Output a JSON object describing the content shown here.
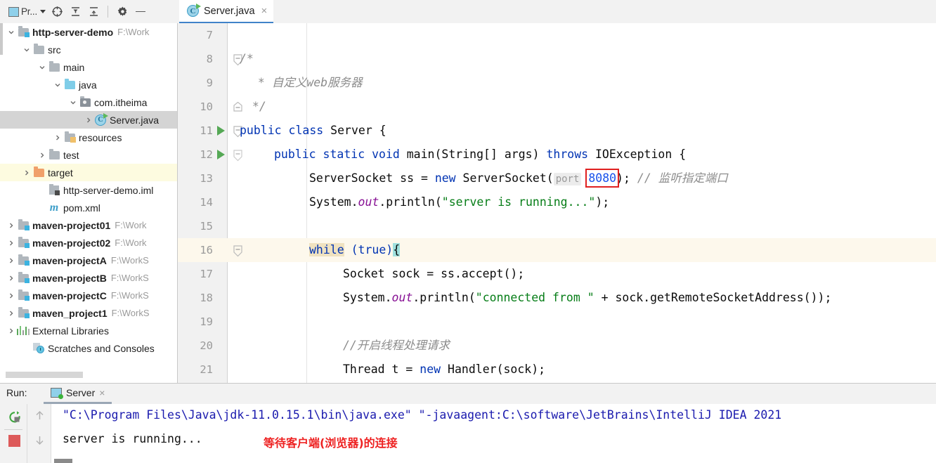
{
  "toolbar": {
    "project_label": "Pr...",
    "icons": [
      "project-view-icon",
      "locate-icon",
      "expand-all-icon",
      "collapse-all-icon",
      "settings-gear-icon",
      "hide-icon"
    ]
  },
  "tabs": [
    {
      "label": "Server.java",
      "icon": "java-class-icon",
      "close": "×",
      "active": true
    }
  ],
  "sidebar": {
    "items": [
      {
        "label": "http-server-demo",
        "path": "F:\\Work",
        "indent": 0,
        "arrow": "down",
        "icon": "module-folder-icon",
        "bold": true
      },
      {
        "label": "src",
        "path": "",
        "indent": 1,
        "arrow": "down",
        "icon": "folder-icon",
        "bold": false
      },
      {
        "label": "main",
        "path": "",
        "indent": 2,
        "arrow": "down",
        "icon": "folder-icon",
        "bold": false
      },
      {
        "label": "java",
        "path": "",
        "indent": 3,
        "arrow": "down",
        "icon": "source-folder-icon",
        "bold": false
      },
      {
        "label": "com.itheima",
        "path": "",
        "indent": 4,
        "arrow": "down",
        "icon": "package-icon",
        "bold": false
      },
      {
        "label": "Server.java",
        "path": "",
        "indent": 5,
        "arrow": "right",
        "icon": "java-class-icon",
        "bold": false,
        "state": "selected"
      },
      {
        "label": "resources",
        "path": "",
        "indent": 4,
        "arrow": "right",
        "icon": "resources-folder-icon",
        "bold": false
      },
      {
        "label": "test",
        "path": "",
        "indent": 3,
        "arrow": "right",
        "icon": "folder-icon",
        "bold": false
      },
      {
        "label": "target",
        "path": "",
        "indent": 2,
        "arrow": "right",
        "icon": "excluded-folder-icon",
        "bold": false,
        "state": "highlighted"
      },
      {
        "label": "http-server-demo.iml",
        "path": "",
        "indent": 3,
        "arrow": "none",
        "icon": "iml-file-icon",
        "bold": false
      },
      {
        "label": "pom.xml",
        "path": "",
        "indent": 3,
        "arrow": "none",
        "icon": "maven-file-icon",
        "bold": false
      },
      {
        "label": "maven-project01",
        "path": "F:\\Work",
        "indent": 0,
        "arrow": "right",
        "icon": "module-folder-icon",
        "bold": true
      },
      {
        "label": "maven-project02",
        "path": "F:\\Work",
        "indent": 0,
        "arrow": "right",
        "icon": "module-folder-icon",
        "bold": true
      },
      {
        "label": "maven-projectA",
        "path": "F:\\WorkS",
        "indent": 0,
        "arrow": "right",
        "icon": "module-folder-icon",
        "bold": true
      },
      {
        "label": "maven-projectB",
        "path": "F:\\WorkS",
        "indent": 0,
        "arrow": "right",
        "icon": "module-folder-icon",
        "bold": true
      },
      {
        "label": "maven-projectC",
        "path": "F:\\WorkS",
        "indent": 0,
        "arrow": "right",
        "icon": "module-folder-icon",
        "bold": true
      },
      {
        "label": "maven_project1",
        "path": "F:\\WorkS",
        "indent": 0,
        "arrow": "right",
        "icon": "module-folder-icon",
        "bold": true
      },
      {
        "label": "External Libraries",
        "path": "",
        "indent": 0,
        "arrow": "right",
        "icon": "libraries-icon",
        "bold": false
      },
      {
        "label": "Scratches and Consoles",
        "path": "",
        "indent": 0,
        "arrow": "none",
        "icon": "scratches-icon",
        "bold": false
      }
    ]
  },
  "editor": {
    "file": "Server.java",
    "first_line_number": 7,
    "lines": [
      {
        "num": "7",
        "runmark": false,
        "fold": "none",
        "cur": false
      },
      {
        "num": "8",
        "runmark": false,
        "fold": "open",
        "cur": false
      },
      {
        "num": "9",
        "runmark": false,
        "fold": "none",
        "cur": false
      },
      {
        "num": "10",
        "runmark": false,
        "fold": "end",
        "cur": false
      },
      {
        "num": "11",
        "runmark": true,
        "fold": "open",
        "cur": false
      },
      {
        "num": "12",
        "runmark": true,
        "fold": "open",
        "cur": false
      },
      {
        "num": "13",
        "runmark": false,
        "fold": "none",
        "cur": false
      },
      {
        "num": "14",
        "runmark": false,
        "fold": "none",
        "cur": false
      },
      {
        "num": "15",
        "runmark": false,
        "fold": "none",
        "cur": false
      },
      {
        "num": "16",
        "runmark": false,
        "fold": "open",
        "cur": true
      },
      {
        "num": "17",
        "runmark": false,
        "fold": "none",
        "cur": false
      },
      {
        "num": "18",
        "runmark": false,
        "fold": "none",
        "cur": false
      },
      {
        "num": "19",
        "runmark": false,
        "fold": "none",
        "cur": false
      },
      {
        "num": "20",
        "runmark": false,
        "fold": "none",
        "cur": false
      },
      {
        "num": "21",
        "runmark": false,
        "fold": "none",
        "cur": false
      }
    ],
    "code": {
      "l8": "/*",
      "l9_star": " * ",
      "l9_text": "自定义web服务器",
      "l10": " */",
      "l11_public": "public",
      "l11_class": "class",
      "l11_name": "Server {",
      "l12_mods": "public static void",
      "l12_main": "main",
      "l12_args": "(String[] args) ",
      "l12_throws": "throws",
      "l12_rest": " IOException {",
      "l13_a": "ServerSocket ss = ",
      "l13_new": "new",
      "l13_b": " ServerSocket(",
      "l13_hint": "port",
      "l13_port": "8080",
      "l13_c": "); ",
      "l13_comment": "// 监听指定端口",
      "l14_a": "System.",
      "l14_out": "out",
      "l14_b": ".println(",
      "l14_str": "\"server is running...\"",
      "l14_c": ");",
      "l16_while": "while",
      "l16_cond": " (true)",
      "l16_brace": "{",
      "l17": "Socket sock = ss.accept();",
      "l18_a": "System.",
      "l18_out": "out",
      "l18_b": ".println(",
      "l18_str": "\"connected from \"",
      "l18_c": " + sock.getRemoteSocketAddress());",
      "l20_comment": "//开启线程处理请求",
      "l21_a": "Thread t = ",
      "l21_new": "new",
      "l21_b": " Handler(sock);"
    },
    "highlight_box": {
      "target": "8080",
      "color": "#e02020"
    }
  },
  "run_panel": {
    "run_label": "Run:",
    "tab_label": "Server",
    "tab_close": "×",
    "buttons": [
      "rerun-button",
      "stop-button",
      "scroll-up-button",
      "scroll-down-button"
    ],
    "console": {
      "line1": "\"C:\\Program Files\\Java\\jdk-11.0.15.1\\bin\\java.exe\" \"-javaagent:C:\\software\\JetBrains\\IntelliJ IDEA 2021",
      "line2": "server is running...",
      "annotation": "等待客户端(浏览器)的连接"
    }
  },
  "colors": {
    "accent": "#4083c9",
    "keyword": "#0033b3",
    "string": "#067d17",
    "number": "#1750eb",
    "comment": "#8c8c8c",
    "annotation_red": "#ee2222",
    "selection": "#d4d4d4",
    "current_line": "#fdf8ec"
  }
}
